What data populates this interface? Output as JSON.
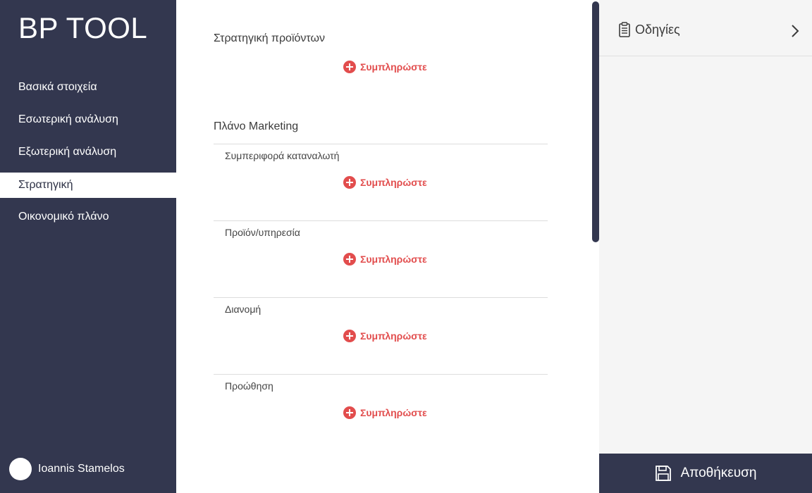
{
  "app": {
    "title": "BP TOOL"
  },
  "sidebar": {
    "items": [
      {
        "label": "Βασικά στοιχεία"
      },
      {
        "label": "Εσωτερική ανάλυση"
      },
      {
        "label": "Εξωτερική ανάλυση"
      },
      {
        "label": "Στρατηγική",
        "active": true
      },
      {
        "label": "Οικονομικό πλάνο"
      }
    ],
    "user": {
      "name": "Ioannis Stamelos"
    }
  },
  "main": {
    "product_strategy": {
      "title": "Στρατηγική προϊόντων",
      "action": "Συμπληρώστε"
    },
    "marketing_plan": {
      "title": "Πλάνο Marketing",
      "subsections": [
        {
          "title": "Συμπεριφορά καταναλωτή",
          "action": "Συμπληρώστε"
        },
        {
          "title": "Προϊόν/υπηρεσία",
          "action": "Συμπληρώστε"
        },
        {
          "title": "Διανομή",
          "action": "Συμπληρώστε"
        },
        {
          "title": "Προώθηση",
          "action": "Συμπληρώστε"
        }
      ]
    }
  },
  "right_panel": {
    "title": "Οδηγίες",
    "save_label": "Αποθήκευση"
  },
  "colors": {
    "sidebar_bg": "#33374f",
    "accent_red": "#e24d4d",
    "panel_bg": "#f5f5f5"
  },
  "icons": {
    "instructions": "clipboard-icon",
    "expand": "chevron-right-icon",
    "add": "plus-circle-icon",
    "save": "floppy-disk-icon"
  }
}
